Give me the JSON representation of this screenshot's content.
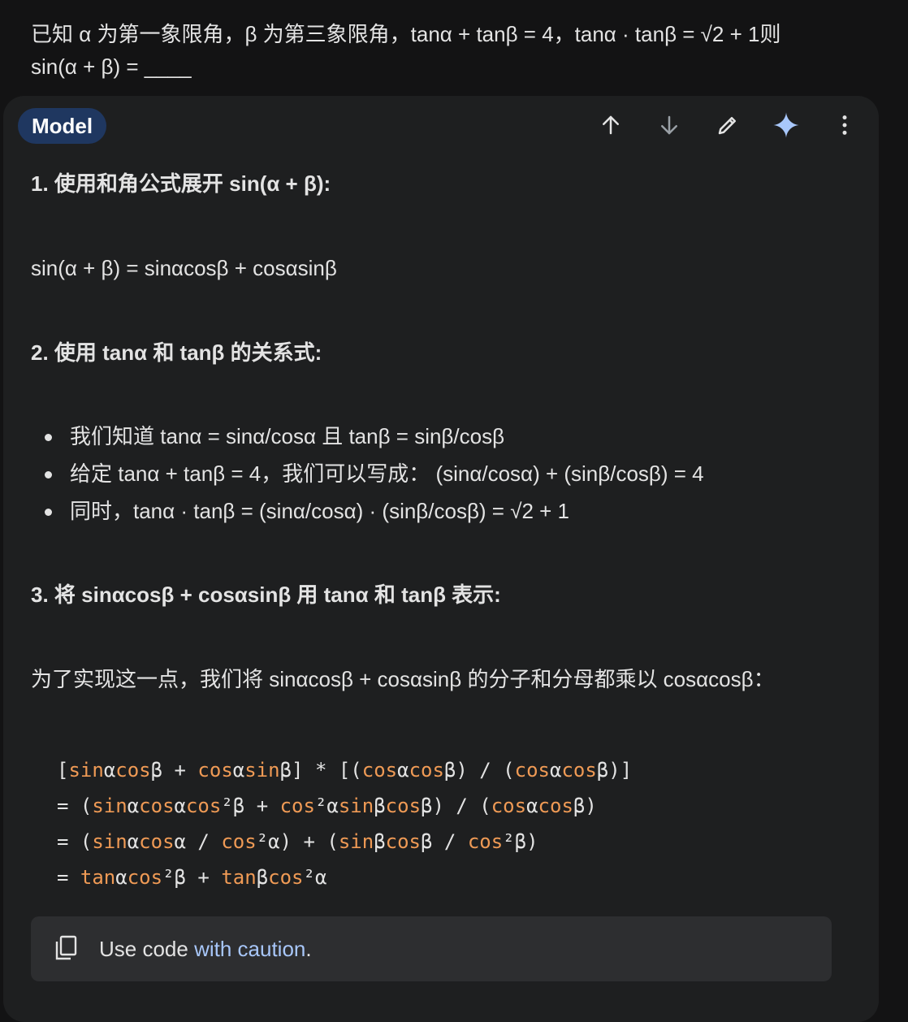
{
  "prompt": {
    "line1": "已知 α 为第一象限角，β 为第三象限角，tanα + tanβ = 4，tanα · tanβ = √2 + 1则",
    "line2": "sin(α + β) = ____"
  },
  "header": {
    "model_label": "Model",
    "icons": [
      "arrow-up-icon",
      "arrow-down-icon",
      "pencil-icon",
      "sparkle-icon",
      "more-vert-icon"
    ],
    "accent_color": "#a8c7fa",
    "chip_color": "#1f3760"
  },
  "response": {
    "step1_heading": "1. 使用和角公式展开 sin(α + β):",
    "step1_formula": "sin(α + β) = sinαcosβ + cosαsinβ",
    "step2_heading": "2. 使用 tanα 和 tanβ 的关系式:",
    "step2_bullets": [
      "我们知道 tanα = sinα/cosα 且 tanβ = sinβ/cosβ",
      "给定 tanα + tanβ = 4，我们可以写成： (sinα/cosα) + (sinβ/cosβ) = 4",
      "同时，tanα · tanβ = (sinα/cosα) · (sinβ/cosβ) = √2 + 1"
    ],
    "step3_heading": "3. 将 sinαcosβ + cosαsinβ 用 tanα 和 tanβ 表示:",
    "step3_text": "为了实现这一点，我们将 sinαcosβ + cosαsinβ 的分子和分母都乘以 cosαcosβ："
  },
  "code_lines": [
    [
      [
        "",
        "["
      ],
      [
        "fn",
        "sin"
      ],
      [
        "",
        "α"
      ],
      [
        "fn",
        "cos"
      ],
      [
        "",
        "β + "
      ],
      [
        "fn",
        "cos"
      ],
      [
        "",
        "α"
      ],
      [
        "fn",
        "sin"
      ],
      [
        "",
        "β] * [("
      ],
      [
        "fn",
        "cos"
      ],
      [
        "",
        "α"
      ],
      [
        "fn",
        "cos"
      ],
      [
        "",
        "β) / ("
      ],
      [
        "fn",
        "cos"
      ],
      [
        "",
        "α"
      ],
      [
        "fn",
        "cos"
      ],
      [
        "",
        "β)]"
      ]
    ],
    [
      [
        "",
        "= ("
      ],
      [
        "fn",
        "sin"
      ],
      [
        "",
        "α"
      ],
      [
        "fn",
        "cos"
      ],
      [
        "",
        "α"
      ],
      [
        "fn",
        "cos"
      ],
      [
        "",
        "²β + "
      ],
      [
        "fn",
        "cos"
      ],
      [
        "",
        "²α"
      ],
      [
        "fn",
        "sin"
      ],
      [
        "",
        "β"
      ],
      [
        "fn",
        "cos"
      ],
      [
        "",
        "β) / ("
      ],
      [
        "fn",
        "cos"
      ],
      [
        "",
        "α"
      ],
      [
        "fn",
        "cos"
      ],
      [
        "",
        "β)"
      ]
    ],
    [
      [
        "",
        "= ("
      ],
      [
        "fn",
        "sin"
      ],
      [
        "",
        "α"
      ],
      [
        "fn",
        "cos"
      ],
      [
        "",
        "α / "
      ],
      [
        "fn",
        "cos"
      ],
      [
        "",
        "²α) + ("
      ],
      [
        "fn",
        "sin"
      ],
      [
        "",
        "β"
      ],
      [
        "fn",
        "cos"
      ],
      [
        "",
        "β / "
      ],
      [
        "fn",
        "cos"
      ],
      [
        "",
        "²β)"
      ]
    ],
    [
      [
        "",
        "= "
      ],
      [
        "fn",
        "tan"
      ],
      [
        "",
        "α"
      ],
      [
        "fn",
        "cos"
      ],
      [
        "",
        "²β + "
      ],
      [
        "fn",
        "tan"
      ],
      [
        "",
        "β"
      ],
      [
        "fn",
        "cos"
      ],
      [
        "",
        "²α"
      ]
    ]
  ],
  "caution": {
    "prefix": "Use code ",
    "link": "with caution",
    "suffix": "."
  }
}
